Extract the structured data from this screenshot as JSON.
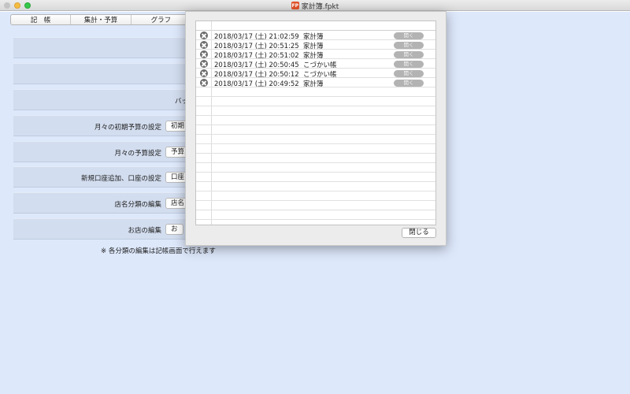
{
  "window": {
    "title": "家計簿.fpkt",
    "app_icon_label": "FP"
  },
  "tabs": [
    "記　帳",
    "集計・予算",
    "グラフ"
  ],
  "settings_rows": [
    {
      "label": "",
      "button": ""
    },
    {
      "label": "",
      "button": ""
    },
    {
      "label": "バッ",
      "button": ""
    },
    {
      "label": "月々の初期予算の設定",
      "button": "初期"
    },
    {
      "label": "月々の予算設定",
      "button": "予算"
    },
    {
      "label": "新規口座追加、口座の設定",
      "button": "口座"
    },
    {
      "label": "店名分類の編集",
      "button": "店名"
    },
    {
      "label": "お店の編集",
      "button": "お"
    }
  ],
  "note": "※ 各分類の編集は記帳画面で行えます",
  "dialog": {
    "entries": [
      {
        "date": "2018/03/17 (土)  21:02:59",
        "book": "家計簿",
        "open_label": "開く"
      },
      {
        "date": "2018/03/17 (土)  20:51:25",
        "book": "家計簿",
        "open_label": "開く"
      },
      {
        "date": "2018/03/17 (土)  20:51:02",
        "book": "家計簿",
        "open_label": "開く"
      },
      {
        "date": "2018/03/17 (土)  20:50:45",
        "book": "こづかい帳",
        "open_label": "開く"
      },
      {
        "date": "2018/03/17 (土)  20:50:12",
        "book": "こづかい帳",
        "open_label": "開く"
      },
      {
        "date": "2018/03/17 (土)  20:49:52",
        "book": "家計簿",
        "open_label": "開く"
      }
    ],
    "empty_rows": 14,
    "close_label": "閉じる"
  }
}
